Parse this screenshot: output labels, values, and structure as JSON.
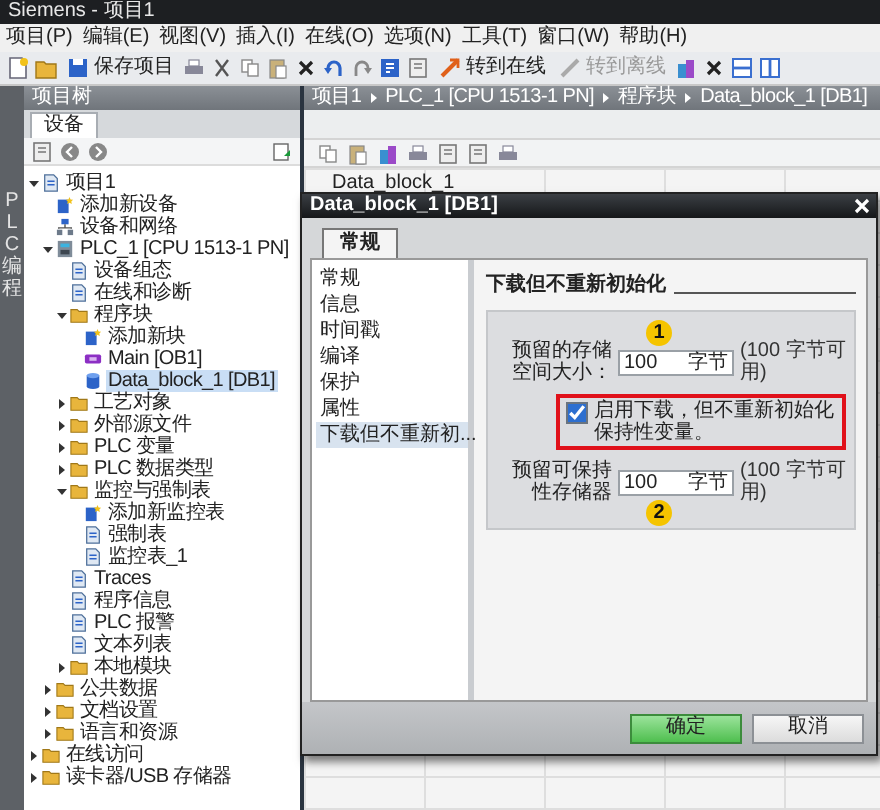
{
  "window": {
    "title": "Siemens - 项目1"
  },
  "menu": [
    "项目(P)",
    "编辑(E)",
    "视图(V)",
    "插入(I)",
    "在线(O)",
    "选项(N)",
    "工具(T)",
    "窗口(W)",
    "帮助(H)"
  ],
  "toolbar": [
    {
      "label": "保存项目",
      "disabled": false
    },
    {
      "label": "转到在线",
      "disabled": false
    },
    {
      "label": "转到离线",
      "disabled": true
    }
  ],
  "side_tab": "PLC 编程",
  "project_tree": {
    "title": "项目树",
    "tabs": [
      {
        "label": "设备",
        "selected": true
      }
    ],
    "items": [
      {
        "label": "项目1",
        "kind": "doc",
        "expanded": true,
        "selected": false,
        "children": [
          {
            "label": "添加新设备",
            "kind": "add",
            "selected": false
          },
          {
            "label": "设备和网络",
            "kind": "network",
            "selected": false
          },
          {
            "label": "PLC_1 [CPU 1513-1 PN]",
            "kind": "plc",
            "expanded": true,
            "selected": false,
            "children": [
              {
                "label": "设备组态",
                "kind": "doc",
                "selected": false
              },
              {
                "label": "在线和诊断",
                "kind": "doc",
                "selected": false
              },
              {
                "label": "程序块",
                "kind": "folder",
                "expanded": true,
                "selected": false,
                "children": [
                  {
                    "label": "添加新块",
                    "kind": "add",
                    "selected": false
                  },
                  {
                    "label": "Main [OB1]",
                    "kind": "block",
                    "selected": false
                  },
                  {
                    "label": "Data_block_1 [DB1]",
                    "kind": "db",
                    "selected": true
                  }
                ]
              },
              {
                "label": "工艺对象",
                "kind": "folder",
                "expanded": false,
                "selected": false
              },
              {
                "label": "外部源文件",
                "kind": "folder",
                "expanded": false,
                "selected": false
              },
              {
                "label": "PLC 变量",
                "kind": "folder",
                "expanded": false,
                "selected": false
              },
              {
                "label": "PLC 数据类型",
                "kind": "folder",
                "expanded": false,
                "selected": false
              },
              {
                "label": "监控与强制表",
                "kind": "folder",
                "expanded": true,
                "selected": false,
                "children": [
                  {
                    "label": "添加新监控表",
                    "kind": "add",
                    "selected": false
                  },
                  {
                    "label": "强制表",
                    "kind": "doc",
                    "selected": false
                  },
                  {
                    "label": "监控表_1",
                    "kind": "doc",
                    "selected": false
                  }
                ]
              },
              {
                "label": "Traces",
                "kind": "doc",
                "selected": false
              },
              {
                "label": "程序信息",
                "kind": "doc",
                "selected": false
              },
              {
                "label": "PLC 报警",
                "kind": "doc",
                "selected": false
              },
              {
                "label": "文本列表",
                "kind": "doc",
                "selected": false
              },
              {
                "label": "本地模块",
                "kind": "folder",
                "expanded": false,
                "selected": false
              }
            ]
          },
          {
            "label": "公共数据",
            "kind": "folder",
            "expanded": false,
            "selected": false
          },
          {
            "label": "文档设置",
            "kind": "folder",
            "expanded": false,
            "selected": false
          },
          {
            "label": "语言和资源",
            "kind": "folder",
            "expanded": false,
            "selected": false
          }
        ]
      },
      {
        "label": "在线访问",
        "kind": "folder",
        "expanded": false,
        "selected": false
      },
      {
        "label": "读卡器/USB 存储器",
        "kind": "folder",
        "expanded": false,
        "selected": false
      }
    ]
  },
  "breadcrumb": [
    "项目1",
    "PLC_1 [CPU 1513-1 PN]",
    "程序块",
    "Data_block_1 [DB1]"
  ],
  "editor": {
    "block_name": "Data_block_1"
  },
  "dialog": {
    "title": "Data_block_1 [DB1]",
    "tabs": [
      {
        "label": "常规",
        "selected": true
      }
    ],
    "nav": [
      {
        "label": "常规",
        "selected": false
      },
      {
        "label": "信息",
        "selected": false
      },
      {
        "label": "时间戳",
        "selected": false
      },
      {
        "label": "编译",
        "selected": false
      },
      {
        "label": "保护",
        "selected": false
      },
      {
        "label": "属性",
        "selected": false
      },
      {
        "label": "下载但不重新初...",
        "selected": true
      }
    ],
    "section_title": "下载但不重新初始化",
    "rows": [
      {
        "kind": "field",
        "label": "预留的存储空间大小：",
        "value": "100",
        "unit": "字节",
        "note": "(100 字节可用)",
        "marker_above": "1"
      },
      {
        "kind": "checkbox",
        "label": "启用下载，但不重新初始化保持性变量。",
        "checked": true,
        "highlighted": true
      },
      {
        "kind": "field",
        "label": "预留可保持性存储器",
        "value": "100",
        "unit": "字节",
        "note": "(100 字节可用)",
        "marker_below": "2"
      }
    ],
    "buttons": [
      {
        "label": "确定",
        "kind": "primary"
      },
      {
        "label": "取消",
        "kind": "secondary"
      }
    ]
  }
}
